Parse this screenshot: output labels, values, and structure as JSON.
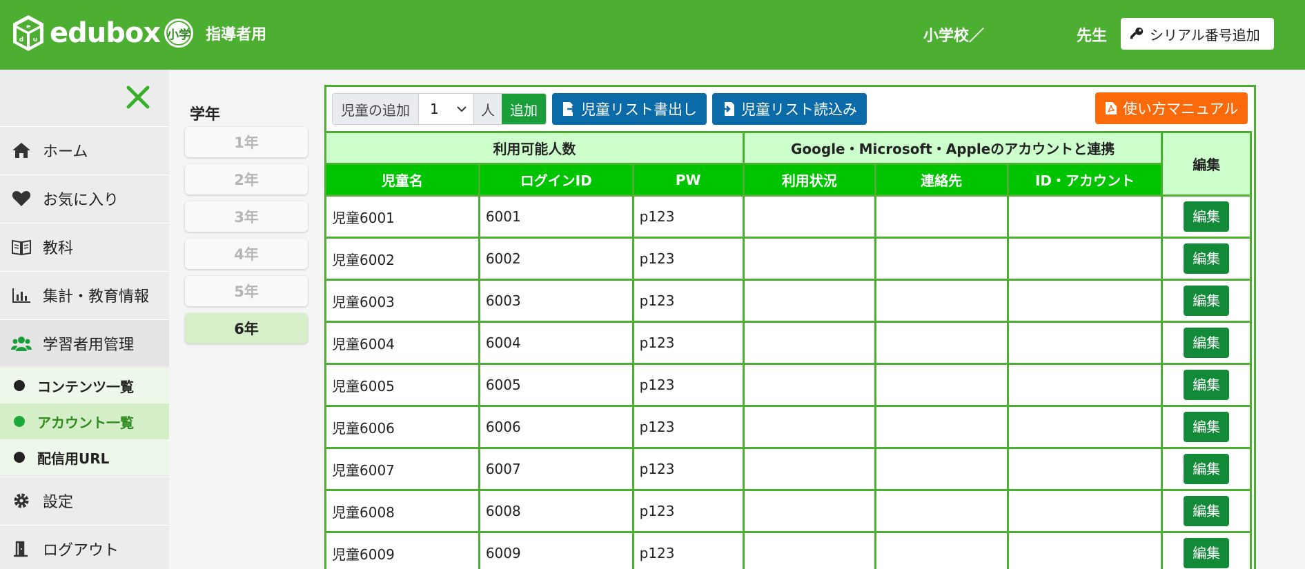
{
  "header": {
    "logo_text": "edubox",
    "logo_badge": "小学",
    "logo_sub": "指導者用",
    "school": "小学校／",
    "teacher": "先生",
    "serial_label": "シリアル番号追加",
    "bg_color": "#4caf32"
  },
  "sidebar": {
    "items": [
      {
        "label": "ホーム",
        "icon": "home-icon"
      },
      {
        "label": "お気に入り",
        "icon": "heart-icon"
      },
      {
        "label": "教科",
        "icon": "book-icon"
      },
      {
        "label": "集計・教育情報",
        "icon": "bar-chart-icon"
      },
      {
        "label": "学習者用管理",
        "icon": "users-icon"
      },
      {
        "label": "設定",
        "icon": "gear-icon"
      },
      {
        "label": "ログアウト",
        "icon": "logout-icon"
      }
    ],
    "sub_items": [
      {
        "label": "コンテンツ一覧",
        "active": false
      },
      {
        "label": "アカウント一覧",
        "active": true
      },
      {
        "label": "配信用URL",
        "active": false
      }
    ]
  },
  "grades": {
    "title": "学年",
    "items": [
      "1年",
      "2年",
      "3年",
      "4年",
      "5年",
      "6年"
    ],
    "active": "6年"
  },
  "toolbar": {
    "add_label": "児童の追加",
    "add_count": "1",
    "add_unit": "人",
    "add_button": "追加",
    "export_label": "児童リスト書出し",
    "import_label": "児童リスト読込み",
    "manual_label": "使い方マニュアル"
  },
  "table": {
    "group1": "利用可能人数",
    "group2": "Google・Microsoft・Appleのアカウントと連携",
    "edit_header": "編集",
    "columns": [
      "児童名",
      "ログインID",
      "PW",
      "利用状況",
      "連絡先",
      "ID・アカウント"
    ],
    "edit_label": "編集",
    "rows": [
      [
        "児童6001",
        "6001",
        "p123",
        "",
        "",
        ""
      ],
      [
        "児童6002",
        "6002",
        "p123",
        "",
        "",
        ""
      ],
      [
        "児童6003",
        "6003",
        "p123",
        "",
        "",
        ""
      ],
      [
        "児童6004",
        "6004",
        "p123",
        "",
        "",
        ""
      ],
      [
        "児童6005",
        "6005",
        "p123",
        "",
        "",
        ""
      ],
      [
        "児童6006",
        "6006",
        "p123",
        "",
        "",
        ""
      ],
      [
        "児童6007",
        "6007",
        "p123",
        "",
        "",
        ""
      ],
      [
        "児童6008",
        "6008",
        "p123",
        "",
        "",
        ""
      ],
      [
        "児童6009",
        "6009",
        "p123",
        "",
        "",
        ""
      ]
    ]
  }
}
